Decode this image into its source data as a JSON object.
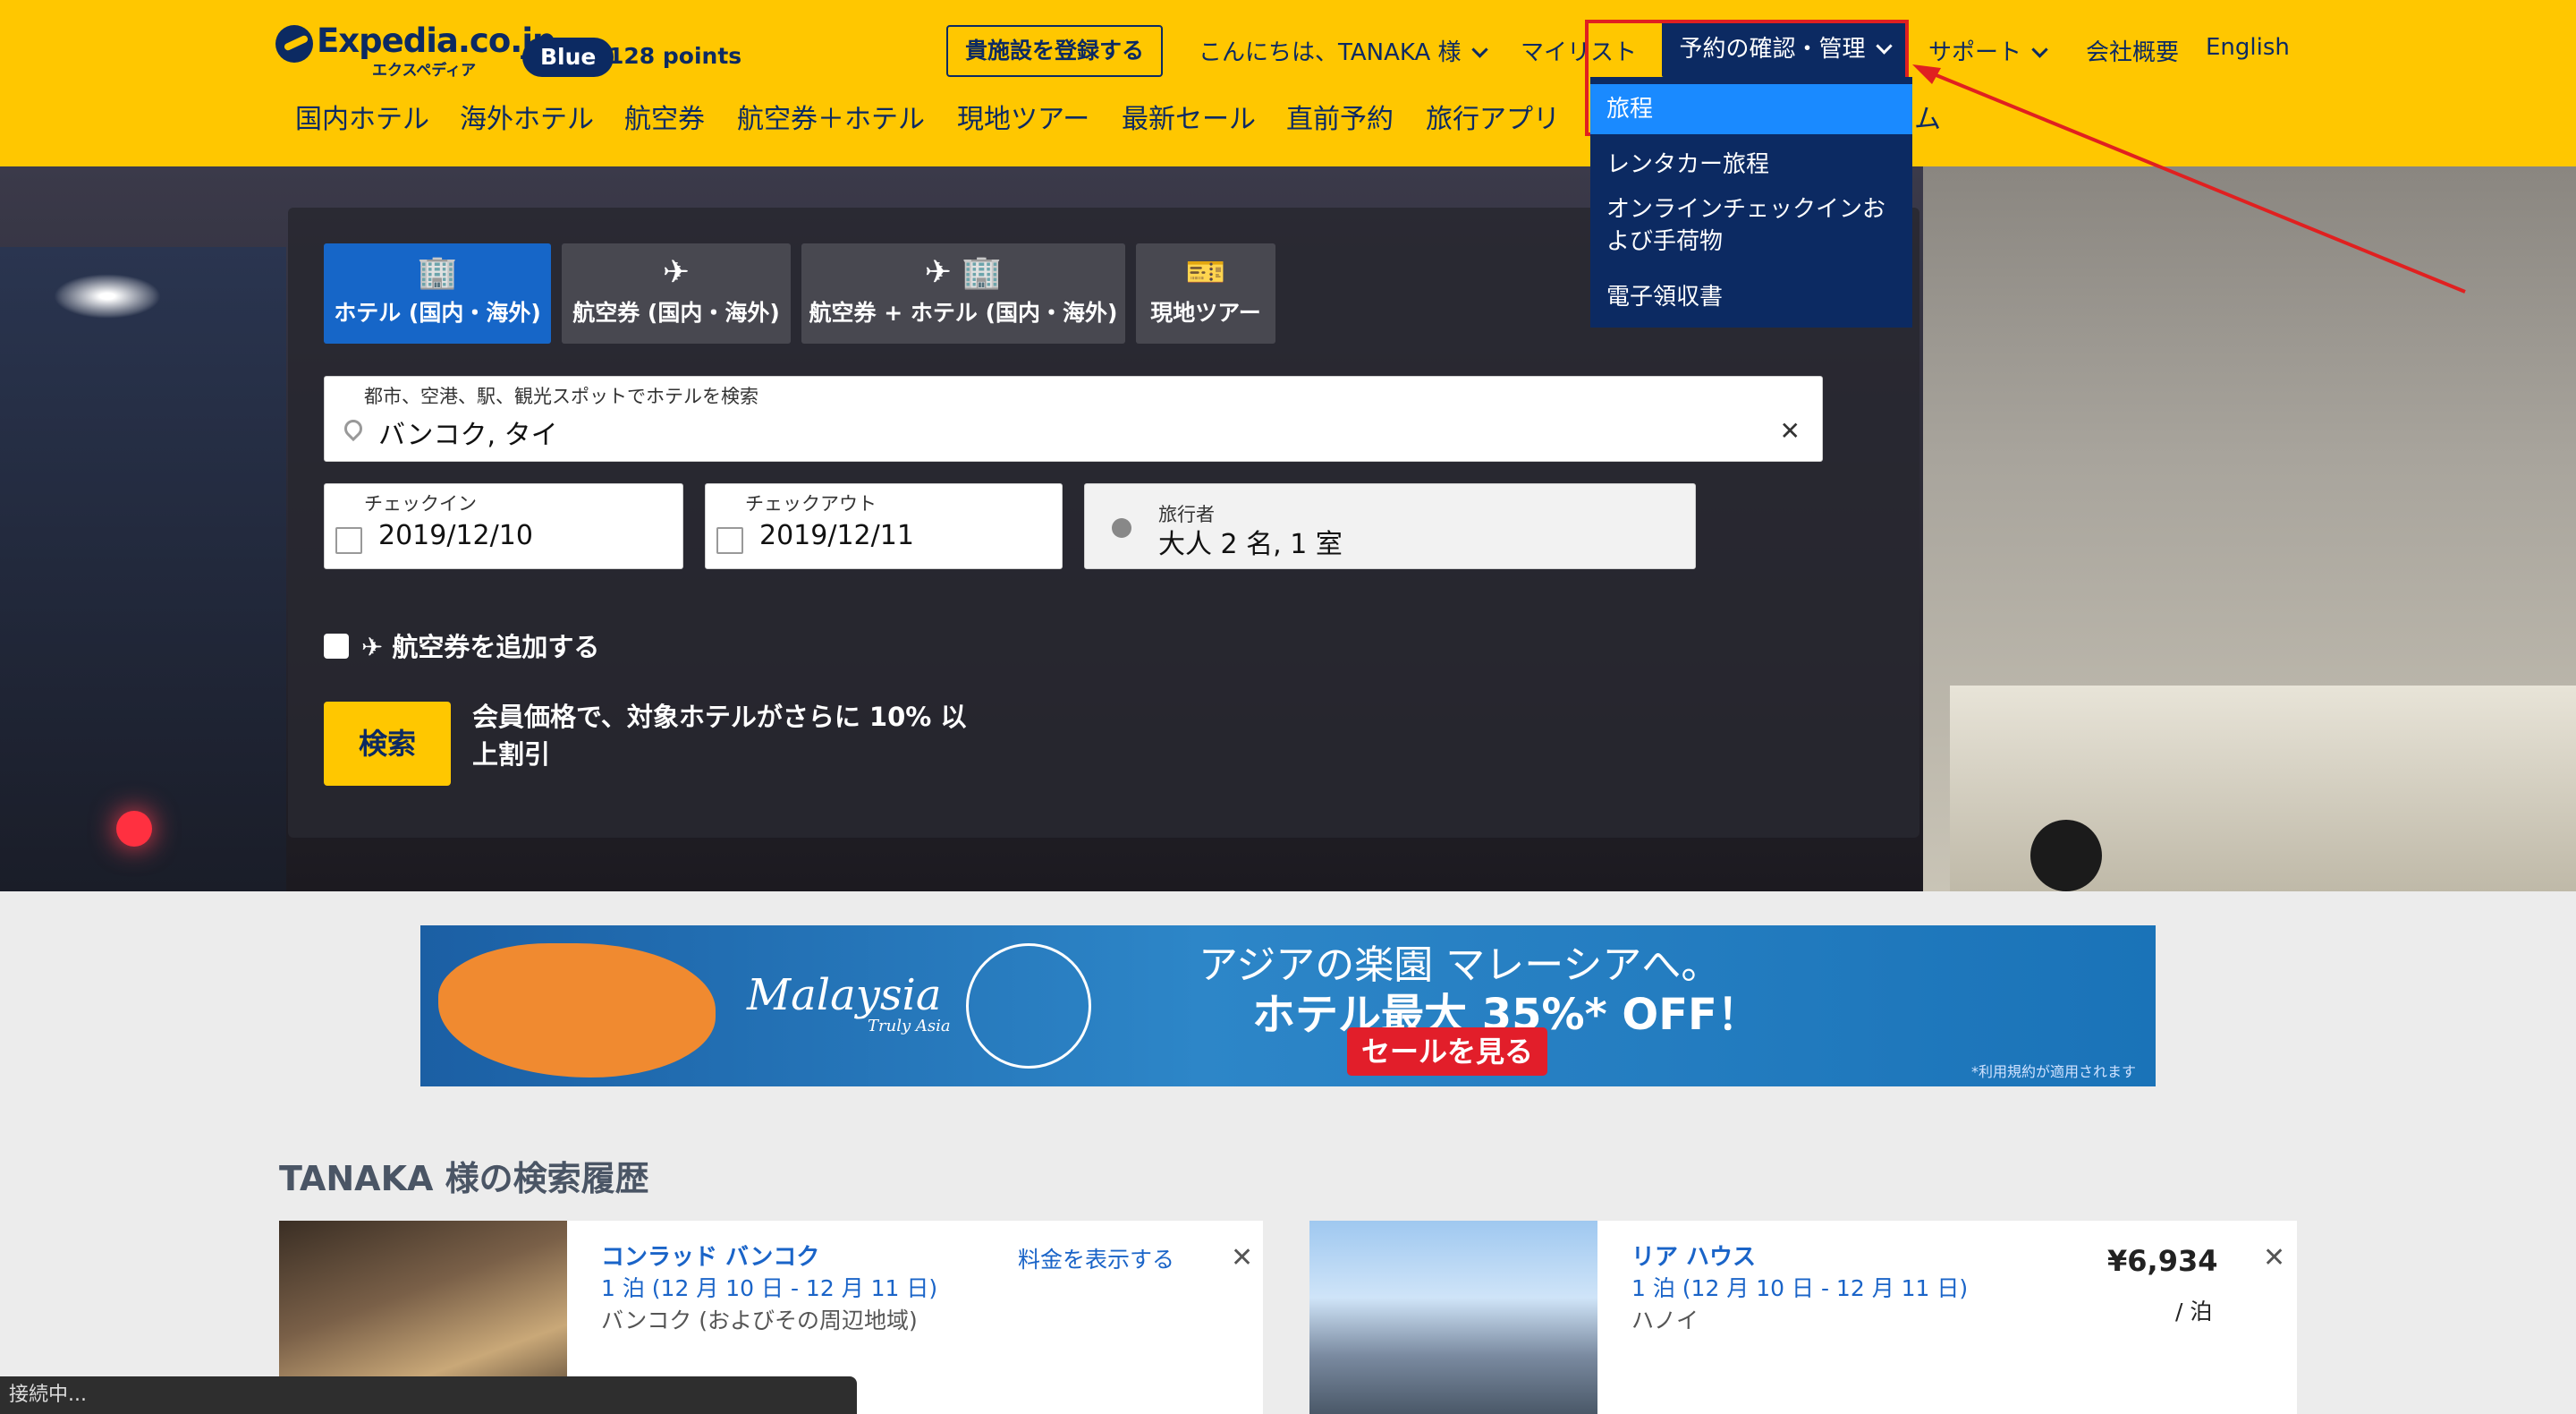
{
  "header": {
    "logo_text": "Expedia.co.jp",
    "logo_sub": "エクスペディア",
    "tier_badge": "Blue",
    "points": "128 points",
    "register_button": "貴施設を登録する",
    "greeting": "こんにちは、TANAKA 様",
    "my_list": "マイリスト",
    "manage": "予約の確認・管理",
    "support": "サポート",
    "company": "会社概要",
    "language": "English",
    "main_nav": [
      "国内ホテル",
      "海外ホテル",
      "航空券",
      "航空券＋ホテル",
      "現地ツアー",
      "最新セール",
      "直前予約",
      "旅行アプリ",
      "ム"
    ]
  },
  "dropdown": {
    "items": [
      "旅程",
      "レンタカー旅程",
      "オンラインチェックインおよび手荷物",
      "電子領収書"
    ],
    "active_index": 0
  },
  "search": {
    "tabs": [
      {
        "label": "ホテル (国内・海外)",
        "icon": "building-icon",
        "glyph": "🏢",
        "active": true
      },
      {
        "label": "航空券 (国内・海外)",
        "icon": "plane-icon",
        "glyph": "✈",
        "active": false
      },
      {
        "label": "航空券 + ホテル (国内・海外)",
        "icon": "plane-building-icon",
        "glyph": "✈ 🏢",
        "active": false
      },
      {
        "label": "現地ツアー",
        "icon": "ticket-icon",
        "glyph": "🎫",
        "active": false
      }
    ],
    "destination_label": "都市、空港、駅、観光スポットでホテルを検索",
    "destination_value": "バンコク, タイ",
    "checkin_label": "チェックイン",
    "checkin_value": "2019/12/10",
    "checkout_label": "チェックアウト",
    "checkout_value": "2019/12/11",
    "travelers_label": "旅行者",
    "travelers_value": "大人 2 名, 1 室",
    "add_flight_label": "航空券を追加する",
    "search_button": "検索",
    "promo_text_1": "会員価格で、対象ホテルがさらに 10% 以",
    "promo_text_2": "上割引"
  },
  "banner": {
    "brand": "Malaysia",
    "tagline": "Truly Asia",
    "headline": "アジアの楽園 マレーシアへ。",
    "offer": "ホテル最大 35%* OFF！",
    "cta": "セールを見る",
    "fine_print": "*利用規約が適用されます"
  },
  "history": {
    "title": "TANAKA 様の検索履歴",
    "cards": [
      {
        "name": "コンラッド バンコク",
        "dates": "1 泊 (12 月 10 日 - 12 月 11 日)",
        "location": "バンコク (およびその周辺地域)",
        "action": "料金を表示する",
        "price": "",
        "per": ""
      },
      {
        "name": "リア ハウス",
        "dates": "1 泊 (12 月 10 日 - 12 月 11 日)",
        "location": "ハノイ",
        "action": "",
        "price": "¥6,934",
        "per": "/ 泊"
      }
    ]
  },
  "status_bar": "接続中..."
}
